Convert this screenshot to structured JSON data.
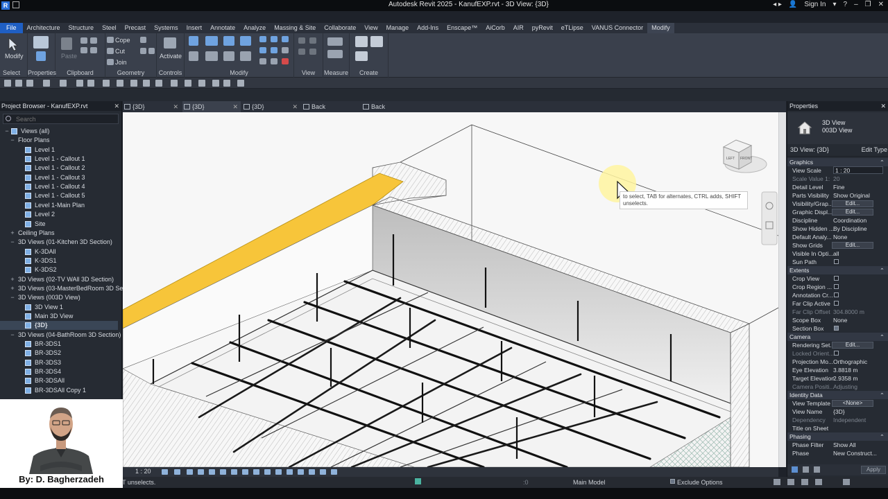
{
  "app": {
    "title": "Autodesk Revit 2025 - KanufEXP.rvt - 3D View: {3D}",
    "sign_in": "Sign In"
  },
  "menu_tabs": [
    "File",
    "Architecture",
    "Structure",
    "Steel",
    "Precast",
    "Systems",
    "Insert",
    "Annotate",
    "Analyze",
    "Massing & Site",
    "Collaborate",
    "View",
    "Manage",
    "Add-Ins",
    "Enscape™",
    "AiCorb",
    "AIR",
    "pyRevit",
    "eTLipse",
    "VANUS Connector",
    "Modify"
  ],
  "ribbon": {
    "modify_label": "Modify",
    "paste_label": "Paste",
    "cope_label": "Cope",
    "cut_label": "Cut",
    "join_label": "Join",
    "activate_label": "Activate",
    "groups": [
      "Select",
      "Properties",
      "Clipboard",
      "Geometry",
      "Controls",
      "Modify",
      "View",
      "Measure",
      "Create"
    ]
  },
  "project_browser": {
    "title": "Project Browser - KanufEXP.rvt",
    "search_placeholder": "Search",
    "tree": [
      {
        "label": "Views (all)",
        "level": 0,
        "toggle": "−",
        "icon": "views-icon"
      },
      {
        "label": "Floor Plans",
        "level": 1,
        "toggle": "−"
      },
      {
        "label": "Level 1",
        "level": 2,
        "icon": "view-icon"
      },
      {
        "label": "Level 1 - Callout 1",
        "level": 2,
        "icon": "view-icon"
      },
      {
        "label": "Level 1 - Callout 2",
        "level": 2,
        "icon": "view-icon"
      },
      {
        "label": "Level 1 - Callout 3",
        "level": 2,
        "icon": "view-icon"
      },
      {
        "label": "Level 1 - Callout 4",
        "level": 2,
        "icon": "view-icon"
      },
      {
        "label": "Level 1 - Callout 5",
        "level": 2,
        "icon": "view-icon"
      },
      {
        "label": "Level 1-Main Plan",
        "level": 2,
        "icon": "view-icon"
      },
      {
        "label": "Level 2",
        "level": 2,
        "icon": "view-icon"
      },
      {
        "label": "Site",
        "level": 2,
        "icon": "view-icon"
      },
      {
        "label": "Ceiling Plans",
        "level": 1,
        "toggle": "+"
      },
      {
        "label": "3D Views (01-Kitchen 3D Section)",
        "level": 1,
        "toggle": "−"
      },
      {
        "label": "K-3DAll",
        "level": 2,
        "icon": "view-icon"
      },
      {
        "label": "K-3DS1",
        "level": 2,
        "icon": "view-icon"
      },
      {
        "label": "K-3DS2",
        "level": 2,
        "icon": "view-icon"
      },
      {
        "label": "3D Views (02-TV WAll 3D Section)",
        "level": 1,
        "toggle": "+"
      },
      {
        "label": "3D Views (03-MasterBedRoom 3D Sect",
        "level": 1,
        "toggle": "+"
      },
      {
        "label": "3D Views (003D View)",
        "level": 1,
        "toggle": "−"
      },
      {
        "label": "3D View 1",
        "level": 2,
        "icon": "view-icon"
      },
      {
        "label": "Main 3D View",
        "level": 2,
        "icon": "view-icon"
      },
      {
        "label": "{3D}",
        "level": 2,
        "icon": "view-icon",
        "bold": true
      },
      {
        "label": "3D Views (04-BathRoom 3D Section)",
        "level": 1,
        "toggle": "−"
      },
      {
        "label": "BR-3DS1",
        "level": 2,
        "icon": "view-icon"
      },
      {
        "label": "BR-3DS2",
        "level": 2,
        "icon": "view-icon"
      },
      {
        "label": "BR-3DS3",
        "level": 2,
        "icon": "view-icon"
      },
      {
        "label": "BR-3DS4",
        "level": 2,
        "icon": "view-icon"
      },
      {
        "label": "BR-3DSAll",
        "level": 2,
        "icon": "view-icon"
      },
      {
        "label": "BR-3DSAll Copy 1",
        "level": 2,
        "icon": "view-icon"
      }
    ]
  },
  "view_tabs": [
    {
      "label": "{3D}",
      "active": false
    },
    {
      "label": "{3D}",
      "active": true
    },
    {
      "label": "{3D}",
      "active": false
    },
    {
      "label": "Back",
      "active": false
    },
    {
      "label": "Back",
      "active": false
    }
  ],
  "tooltip": "to select, TAB for alternates, CTRL adds, SHIFT unselects.",
  "viewcube": {
    "left": "LEFT",
    "front": "FRONT"
  },
  "view_bar": {
    "scale": "1 : 20"
  },
  "status": {
    "message": "T unselects.",
    "model": "Main Model",
    "exclude": "Exclude Options",
    "zero": ":0"
  },
  "properties": {
    "title": "Properties",
    "type_name_1": "3D View",
    "type_name_2": "003D View",
    "instance": "3D View: {3D}",
    "edit_type": "Edit Type",
    "apply": "Apply",
    "sections": [
      {
        "name": "Graphics",
        "rows": [
          {
            "k": "View Scale",
            "v": "1 : 20",
            "input": true
          },
          {
            "k": "Scale Value  1:",
            "v": "20",
            "dis": true
          },
          {
            "k": "Detail Level",
            "v": "Fine"
          },
          {
            "k": "Parts Visibility",
            "v": "Show Original"
          },
          {
            "k": "Visibility/Grap...",
            "btn": "Edit..."
          },
          {
            "k": "Graphic Displ...",
            "btn": "Edit..."
          },
          {
            "k": "Discipline",
            "v": "Coordination"
          },
          {
            "k": "Show Hidden ...",
            "v": "By Discipline"
          },
          {
            "k": "Default Analy...",
            "v": "None"
          },
          {
            "k": "Show Grids",
            "btn": "Edit..."
          },
          {
            "k": "Visible In Opti...",
            "v": "all"
          },
          {
            "k": "Sun Path",
            "chk": false
          }
        ]
      },
      {
        "name": "Extents",
        "rows": [
          {
            "k": "Crop View",
            "chk": false
          },
          {
            "k": "Crop Region ...",
            "chk": false
          },
          {
            "k": "Annotation Cr...",
            "chk": false
          },
          {
            "k": "Far Clip Active",
            "chk": false
          },
          {
            "k": "Far Clip Offset",
            "v": "304.8000 m",
            "dis": true
          },
          {
            "k": "Scope Box",
            "v": "None"
          },
          {
            "k": "Section Box",
            "chk": true
          }
        ]
      },
      {
        "name": "Camera",
        "rows": [
          {
            "k": "Rendering Set...",
            "btn": "Edit..."
          },
          {
            "k": "Locked Orient...",
            "dis": true,
            "chk": false
          },
          {
            "k": "Projection Mo...",
            "v": "Orthographic"
          },
          {
            "k": "Eye Elevation",
            "v": "3.8818 m"
          },
          {
            "k": "Target Elevation",
            "v": "2.9358 m"
          },
          {
            "k": "Camera Positi...",
            "v": "Adjusting",
            "dis": true
          }
        ]
      },
      {
        "name": "Identity Data",
        "rows": [
          {
            "k": "View Template",
            "btn": "<None>"
          },
          {
            "k": "View Name",
            "v": "{3D}"
          },
          {
            "k": "Dependency",
            "v": "Independent",
            "dis": true
          },
          {
            "k": "Title on Sheet",
            "v": ""
          }
        ]
      },
      {
        "name": "Phasing",
        "rows": [
          {
            "k": "Phase Filter",
            "v": "Show All"
          },
          {
            "k": "Phase",
            "v": "New Construct..."
          }
        ]
      }
    ]
  },
  "presenter": {
    "caption": "By: D. Bagherzadeh"
  },
  "colors": {
    "accent": "#1f5fc4",
    "ribbon": "#3a404c",
    "panel": "#262b33",
    "strip": "#f7c53a",
    "viewport": "#f5f5f5"
  }
}
